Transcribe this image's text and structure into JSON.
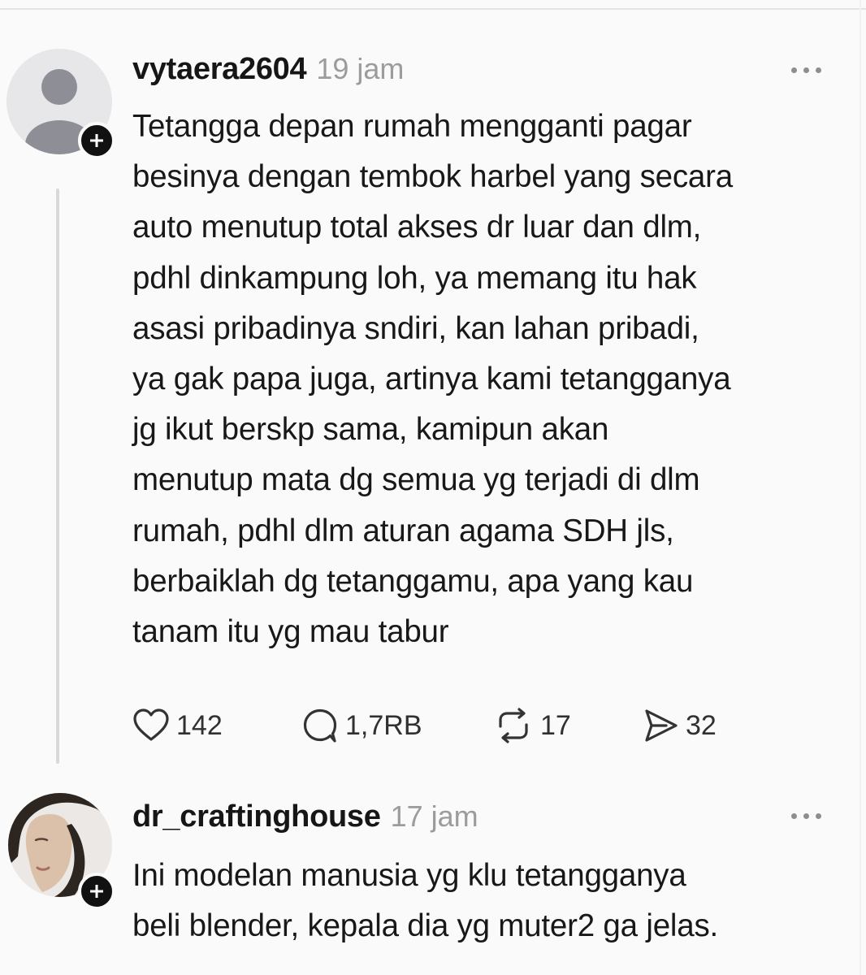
{
  "posts": [
    {
      "username": "vytaera2604",
      "time": "19 jam",
      "avatar": "default-avatar-icon",
      "lines": [
        "Tetangga depan rumah mengganti pagar",
        "besinya dengan tembok harbel yang secara",
        "auto menutup total akses dr luar dan dlm,",
        "pdhl dinkampung loh, ya memang itu hak",
        "asasi pribadinya sndiri, kan lahan pribadi,",
        "ya gak papa juga, artinya kami tetangganya",
        "jg ikut berskp sama, kamipun akan",
        "menutup mata dg semua yg terjadi di dlm",
        "rumah, pdhl dlm aturan agama SDH jls,",
        "berbaiklah dg tetanggamu, apa yang kau",
        "tanam itu yg mau tabur"
      ],
      "actions": {
        "likes": "142",
        "replies": "1,7RB",
        "reposts": "17",
        "shares": "32"
      }
    },
    {
      "username": "dr_craftinghouse",
      "time": "17 jam",
      "avatar": "profile-photo",
      "lines": [
        "Ini modelan manusia yg klu tetangganya",
        "beli blender, kepala dia yg muter2 ga jelas."
      ]
    }
  ],
  "icons": {
    "like": "heart-icon",
    "reply": "comment-icon",
    "repost": "repost-icon",
    "share": "send-icon",
    "follow": "plus-icon",
    "menu": "more-icon"
  },
  "colors": {
    "background": "#fafafa",
    "text": "#181818",
    "muted": "#9c9c9c",
    "badge": "#111111"
  }
}
